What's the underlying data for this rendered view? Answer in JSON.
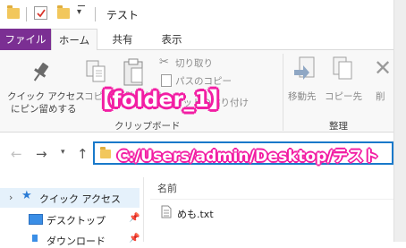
{
  "window": {
    "title": "テスト"
  },
  "ribbon_tabs": [
    "ファイル",
    "ホーム",
    "共有",
    "表示"
  ],
  "ribbon": {
    "pin_label_line1": "クイック アクセス",
    "pin_label_line2": "にピン留めする",
    "copy_label": "コピー",
    "paste_label": "貼り付け",
    "cut_label": "切り取り",
    "copy_path_label": "パスのコピー",
    "shortcut_paste_label": "ショートカットの貼り付け",
    "clipboard_group": "クリップボード",
    "move_to_label": "移動先",
    "copy_to_label": "コピー先",
    "delete_label": "削",
    "organize_group": "整理"
  },
  "overlay": {
    "folder_label": "【folder_1】"
  },
  "address": {
    "path": "C:/Users/admin/Desktop/テスト"
  },
  "nav": {
    "quick_access": "クイック アクセス",
    "desktop": "デスクトップ",
    "downloads": "ダウンロード"
  },
  "content": {
    "column_name": "名前",
    "files": [
      "めも.txt"
    ]
  },
  "colors": {
    "file_tab": "#7b2f93",
    "accent_blue": "#1979ca",
    "overlay_pink": "#f21fa4"
  }
}
